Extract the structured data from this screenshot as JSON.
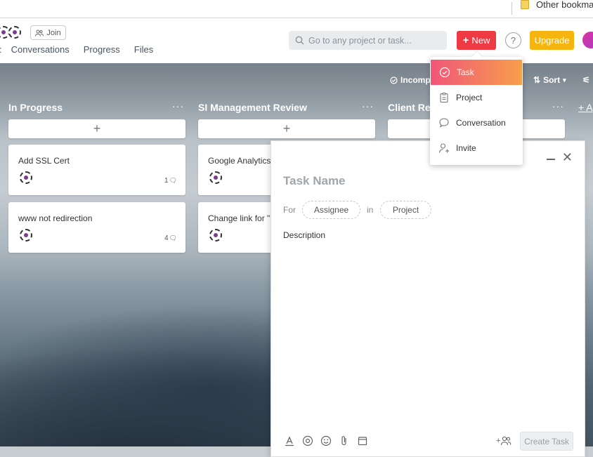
{
  "bookmarks": {
    "other_label": "Other bookmar"
  },
  "header": {
    "join_label": "Join",
    "nav": [
      "Conversations",
      "Progress",
      "Files"
    ],
    "search_placeholder": "Go to any project or task...",
    "new_label": "New",
    "help_label": "?",
    "upgrade_label": "Upgrade",
    "colors": {
      "new": "#ee3a43",
      "upgrade": "#f6b40e"
    }
  },
  "toolbar": {
    "filter_label": "Incompl",
    "sort_label": "Sort"
  },
  "columns": [
    {
      "title": "In Progress",
      "cards": [
        {
          "title": "Add SSL Cert",
          "comments": "1"
        },
        {
          "title": "www not redirection",
          "comments": "4"
        }
      ]
    },
    {
      "title": "SI Management Review",
      "cards": [
        {
          "title": "Google Analytics"
        },
        {
          "title": "Change link for \"("
        }
      ]
    },
    {
      "title": "Client Rev",
      "cards": []
    },
    {
      "title": "+ A",
      "cards": []
    }
  ],
  "new_menu": {
    "items": [
      "Task",
      "Project",
      "Conversation",
      "Invite"
    ],
    "active": "Task"
  },
  "task_modal": {
    "name_placeholder": "Task Name",
    "for_label": "For",
    "assignee_label": "Assignee",
    "in_label": "in",
    "project_label": "Project",
    "description_label": "Description",
    "add_assignee_label": "+",
    "create_label": "Create Task"
  }
}
